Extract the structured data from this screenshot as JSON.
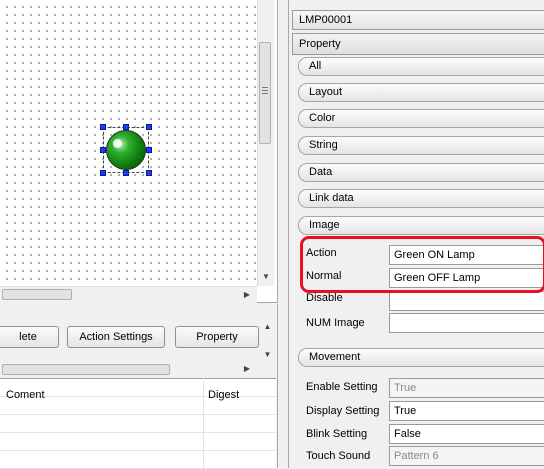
{
  "canvas": {
    "widget": "green-lamp"
  },
  "action_bar": {
    "buttons": [
      "lete",
      "Action Settings",
      "Property"
    ]
  },
  "action_list": {
    "columns": {
      "comment": "Coment",
      "digest": "Digest"
    }
  },
  "properties": {
    "object_id": "LMP00001",
    "tab": "Property",
    "categories": {
      "all": "All",
      "layout": "Layout",
      "color": "Color",
      "string": "String",
      "data": "Data",
      "link_data": "Link data",
      "image": "Image",
      "movement": "Movement"
    },
    "image_props": [
      {
        "label": "Action",
        "value": "Green ON Lamp"
      },
      {
        "label": "Normal",
        "value": "Green OFF Lamp"
      },
      {
        "label": "Disable",
        "value": ""
      },
      {
        "label": "NUM Image",
        "value": ""
      }
    ],
    "movement_props": [
      {
        "label": "Enable Setting",
        "value": "True",
        "enabled": false
      },
      {
        "label": "Display Setting",
        "value": "True",
        "enabled": true
      },
      {
        "label": "Blink Setting",
        "value": "False",
        "enabled": true
      },
      {
        "label": "Touch Sound",
        "value": "Pattern 6",
        "enabled": false
      }
    ]
  },
  "colors": {
    "highlight": "#e8101c",
    "lamp": "#0e7c0e",
    "handles": "#1a3cff"
  }
}
